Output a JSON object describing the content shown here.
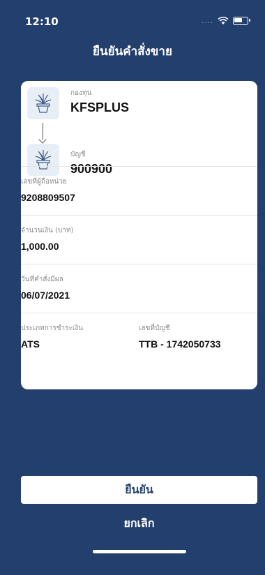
{
  "status_bar": {
    "time": "12:10",
    "signal": "....",
    "icons": [
      "wifi-icon",
      "battery-icon"
    ]
  },
  "header": {
    "title": "ยืนยันคำสั่งขาย"
  },
  "order": {
    "fund_label": "กองทุน",
    "fund_code": "KFSPLUS",
    "account_label": "บัญชี",
    "account_no": "900900",
    "holder_label": "เลขที่ผู้ถือหน่วย",
    "holder_no": "9208809507",
    "amount_label": "จำนวนเงิน (บาท)",
    "amount": "1,000.00",
    "effective_date_label": "วันที่คำสั่งมีผล",
    "effective_date": "06/07/2021",
    "payment_type_label": "ประเภทการชำระเงิน",
    "payment_type": "ATS",
    "bank_account_label": "เลขที่บัญชี",
    "bank_account": "TTB - 1742050733"
  },
  "actions": {
    "confirm_label": "ยืนยัน",
    "cancel_label": "ยกเลิก"
  },
  "colors": {
    "background": "#233f6e",
    "card": "#ffffff",
    "icon_tile": "#e8eef6"
  }
}
